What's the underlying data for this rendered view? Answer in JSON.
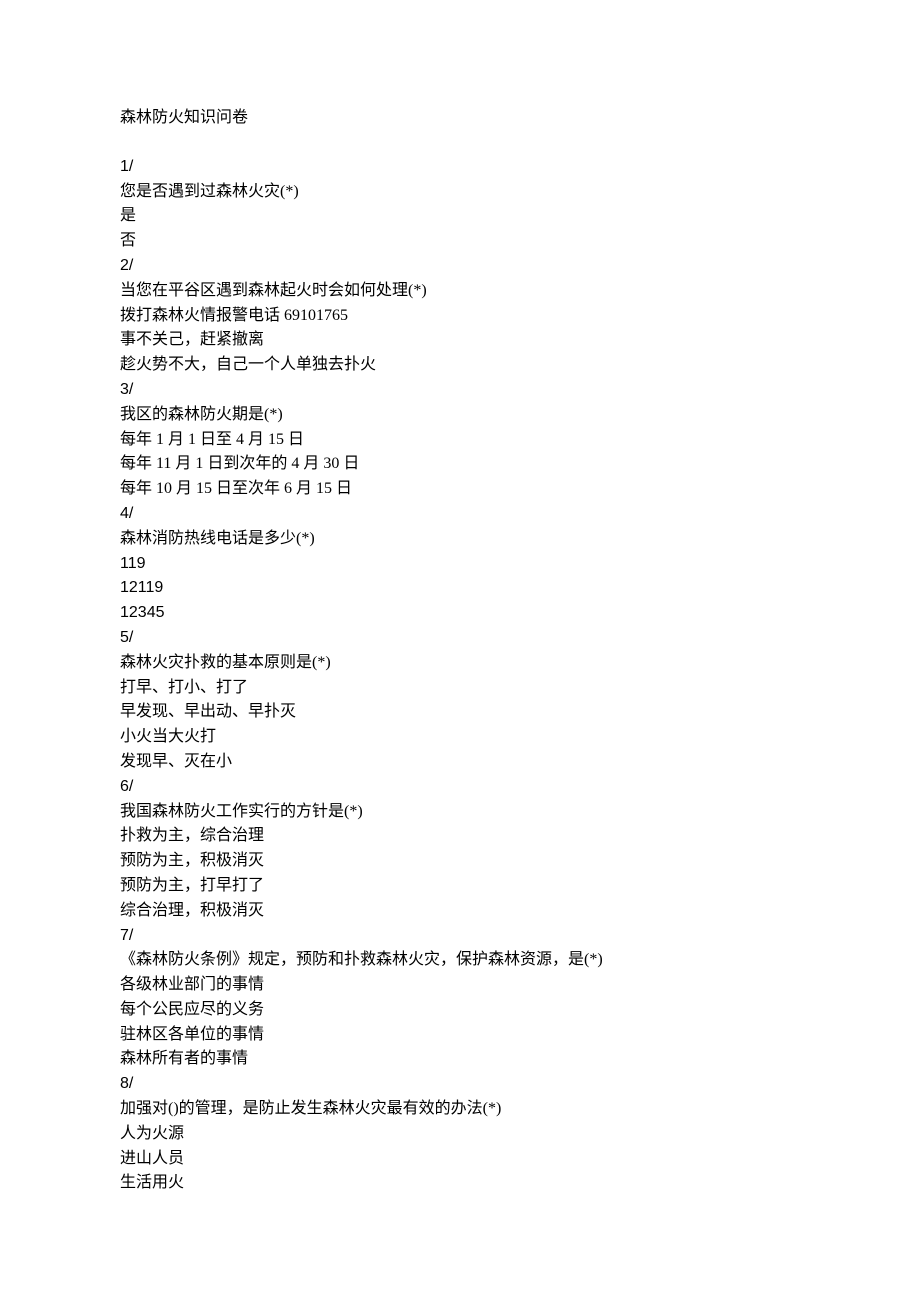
{
  "title": "森林防火知识问卷",
  "questions": [
    {
      "num": "1/",
      "text": "您是否遇到过森林火灾(*)",
      "options": [
        "是",
        "否"
      ]
    },
    {
      "num": "2/",
      "text": "当您在平谷区遇到森林起火时会如何处理(*)",
      "options": [
        "拨打森林火情报警电话 69101765",
        "事不关己，赶紧撤离",
        "趁火势不大，自己一个人单独去扑火"
      ]
    },
    {
      "num": "3/",
      "text": "我区的森林防火期是(*)",
      "options": [
        "每年 1 月 1 日至 4 月 15 日",
        "每年 11 月 1 日到次年的 4 月 30 日",
        "每年 10 月 15 日至次年 6 月 15 日"
      ]
    },
    {
      "num": "4/",
      "text": "森林消防热线电话是多少(*)",
      "options": [
        "119",
        "12119",
        "12345"
      ]
    },
    {
      "num": "5/",
      "text": "森林火灾扑救的基本原则是(*)",
      "options": [
        "打早、打小、打了",
        "早发现、早出动、早扑灭",
        "小火当大火打",
        "发现早、灭在小"
      ]
    },
    {
      "num": "6/",
      "text": "我国森林防火工作实行的方针是(*)",
      "options": [
        "扑救为主，综合治理",
        "预防为主，积极消灭",
        "预防为主，打早打了",
        "综合治理，积极消灭"
      ]
    },
    {
      "num": "7/",
      "text": "《森林防火条例》规定，预防和扑救森林火灾，保护森林资源，是(*)",
      "options": [
        "各级林业部门的事情",
        "每个公民应尽的义务",
        "驻林区各单位的事情",
        "森林所有者的事情"
      ]
    },
    {
      "num": "8/",
      "text": "加强对()的管理，是防止发生森林火灾最有效的办法(*)",
      "options": [
        "人为火源",
        "进山人员",
        "生活用火"
      ]
    }
  ]
}
